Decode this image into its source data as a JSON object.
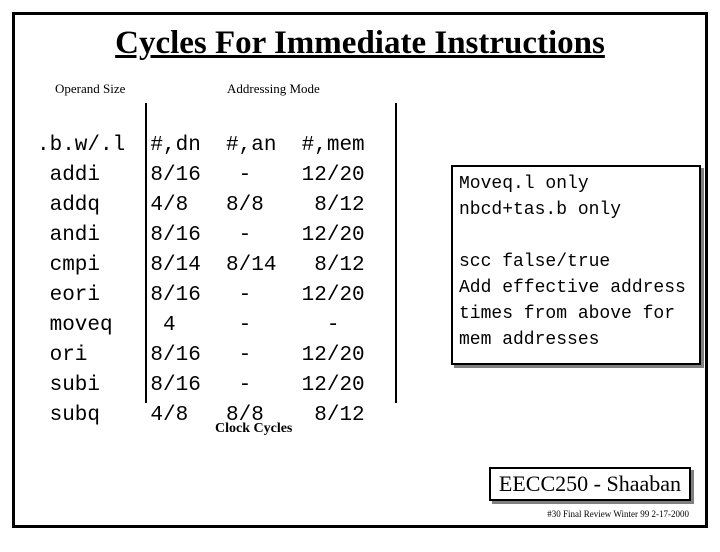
{
  "title": "Cycles For Immediate Instructions",
  "labels": {
    "operand_size": "Operand Size",
    "addressing_mode": "Addressing Mode",
    "clock_cycles": "Clock Cycles"
  },
  "chart_data": {
    "type": "table",
    "title": "Cycles For Immediate Instructions",
    "columns": [
      ".b.w/.l",
      "#,dn",
      "#,an",
      "#,mem"
    ],
    "rows": [
      {
        "instr": "addi",
        "dn": "8/16",
        "an": "-",
        "mem": "12/20"
      },
      {
        "instr": "addq",
        "dn": "4/8",
        "an": "8/8",
        "mem": "8/12"
      },
      {
        "instr": "andi",
        "dn": "8/16",
        "an": "-",
        "mem": "12/20"
      },
      {
        "instr": "cmpi",
        "dn": "8/14",
        "an": "8/14",
        "mem": "8/12"
      },
      {
        "instr": "eori",
        "dn": "8/16",
        "an": "-",
        "mem": "12/20"
      },
      {
        "instr": "moveq",
        "dn": "4",
        "an": "-",
        "mem": "-"
      },
      {
        "instr": "ori",
        "dn": "8/16",
        "an": "-",
        "mem": "12/20"
      },
      {
        "instr": "subi",
        "dn": "8/16",
        "an": "-",
        "mem": "12/20"
      },
      {
        "instr": "subq",
        "dn": "4/8",
        "an": "8/8",
        "mem": "8/12"
      }
    ]
  },
  "header_row": ".b.w/.l  #,dn  #,an  #,mem",
  "body_rows": [
    " addi    8/16   -    12/20",
    " addq    4/8   8/8    8/12",
    " andi    8/16   -    12/20",
    " cmpi    8/14  8/14   8/12",
    " eori    8/16   -    12/20",
    " moveq    4     -      -",
    " ori     8/16   -    12/20",
    " subi    8/16   -    12/20",
    " subq    4/8   8/8    8/12"
  ],
  "notes": [
    "Moveq.l only",
    "nbcd+tas.b only",
    "",
    "scc false/true",
    "Add effective address times from above for mem addresses"
  ],
  "footer": {
    "badge": "EECC250 - Shaaban",
    "small": "#30 Final Review Winter 99  2-17-2000"
  }
}
